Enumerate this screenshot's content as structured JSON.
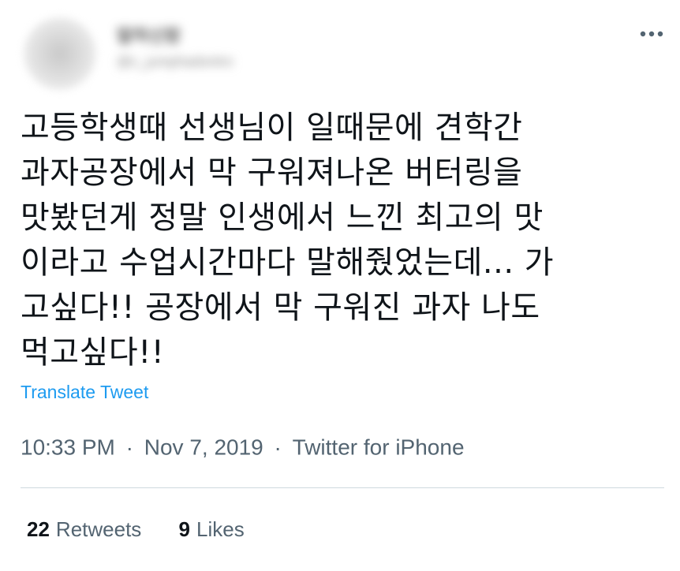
{
  "author": {
    "name": "말하신랑",
    "handle": "@c_jumphadontro"
  },
  "tweet": {
    "text": "고등학생때 선생님이 일때문에 견학간\n과자공장에서 막 구워져나온 버터링을\n맛봤던게 정말 인생에서 느낀 최고의 맛\n이라고 수업시간마다 말해줬었는데... 가\n고싶다!! 공장에서 막 구워진 과자 나도\n먹고싶다!!",
    "translate_label": "Translate Tweet"
  },
  "meta": {
    "time": "10:33 PM",
    "date": "Nov 7, 2019",
    "source": "Twitter for iPhone",
    "separator": "·"
  },
  "stats": {
    "retweets_count": "22",
    "retweets_label": "Retweets",
    "likes_count": "9",
    "likes_label": "Likes"
  },
  "icons": {
    "more": "more-horizontal-icon"
  },
  "colors": {
    "link": "#1d9bf0",
    "text": "#0f1419",
    "secondary": "#536471",
    "divider": "#cfd9de"
  }
}
